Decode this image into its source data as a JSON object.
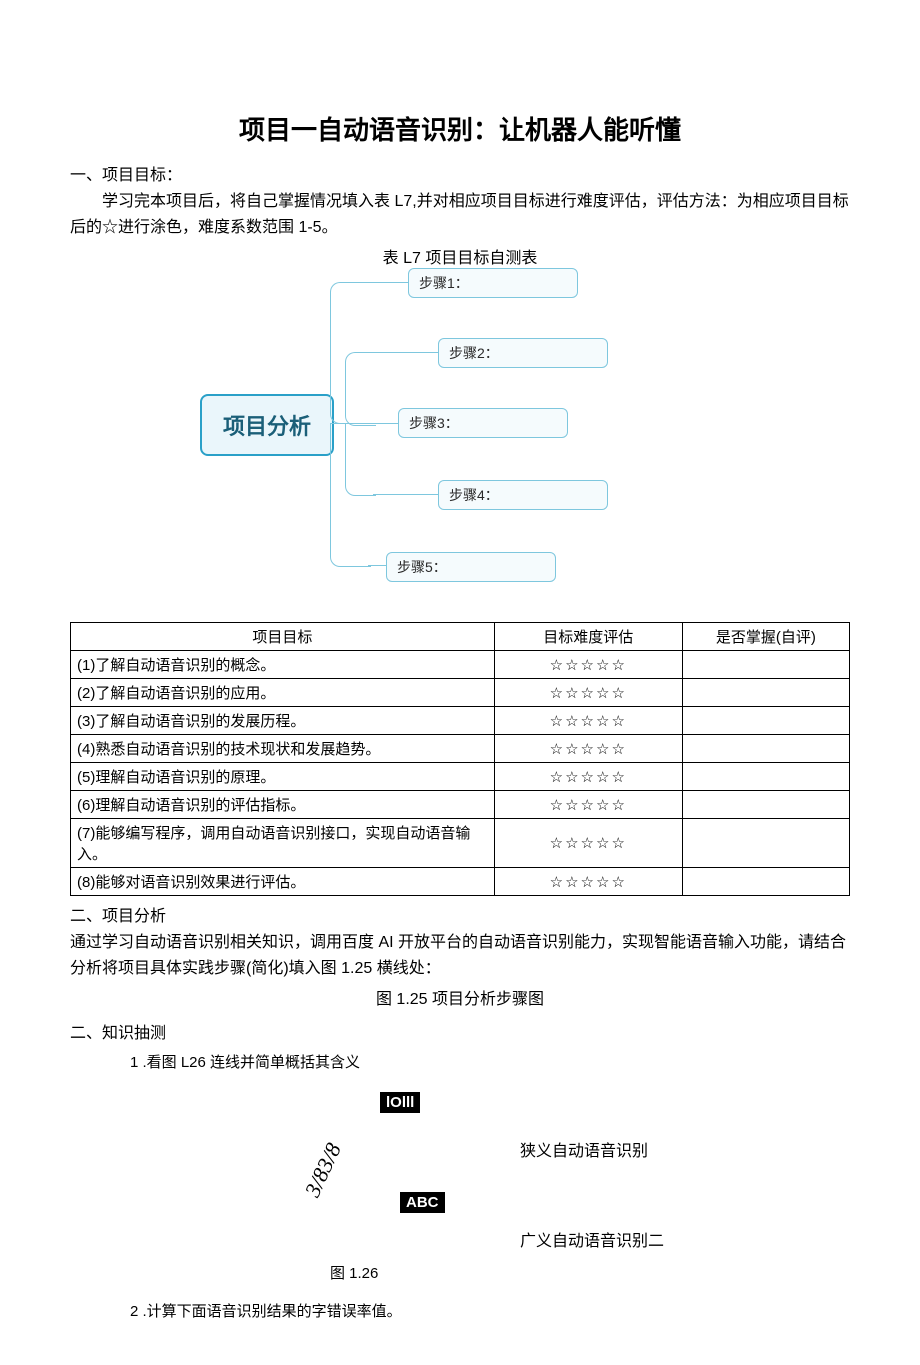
{
  "title": "项目一自动语音识别：让机器人能听懂",
  "sec1_head": "一、项目目标：",
  "sec1_p1": "学习完本项目后，将自己掌握情况填入表 L7,并对相应项目目标进行难度评估，评估方法：为相应项目目标后的☆进行涂色，难度系数范围 1-5。",
  "table_caption": "表 L7 项目目标自测表",
  "mindmap": {
    "root": "项目分析",
    "nodes": [
      "步骤1：",
      "步骤2：",
      "步骤3：",
      "步骤4：",
      "步骤5："
    ]
  },
  "table": {
    "headers": {
      "c1": "项目目标",
      "c2": "目标难度评估",
      "c3": "是否掌握(自评)"
    },
    "stars": "☆☆☆☆☆",
    "rows": [
      "(1)了解自动语音识别的概念。",
      "(2)了解自动语音识别的应用。",
      "(3)了解自动语音识别的发展历程。",
      "(4)熟悉自动语音识别的技术现状和发展趋势。",
      "(5)理解自动语音识别的原理。",
      "(6)理解自动语音识别的评估指标。",
      "(7)能够编写程序，调用自动语音识别接口，实现自动语音输入。",
      "(8)能够对语音识别效果进行评估。"
    ]
  },
  "sec2_head": "二、项目分析",
  "sec2_p1": "通过学习自动语音识别相关知识，调用百度 AI 开放平台的自动语音识别能力，实现智能语音输入功能，请结合分析将项目具体实践步骤(简化)填入图 1.25 横线处：",
  "fig125": "图 1.25 项目分析步骤图",
  "sec3_head": "二、知识抽测",
  "q1": "1 .看图 L26 连线并简单概括其含义",
  "q_diagram": {
    "box1": "lOlll",
    "box2": "ABC",
    "rot": "3/83/8",
    "right1": "狭义自动语音识别",
    "right2": "广义自动语音识别二",
    "caption": "图 1.26"
  },
  "q2": "2 .计算下面语音识别结果的字错误率值。"
}
